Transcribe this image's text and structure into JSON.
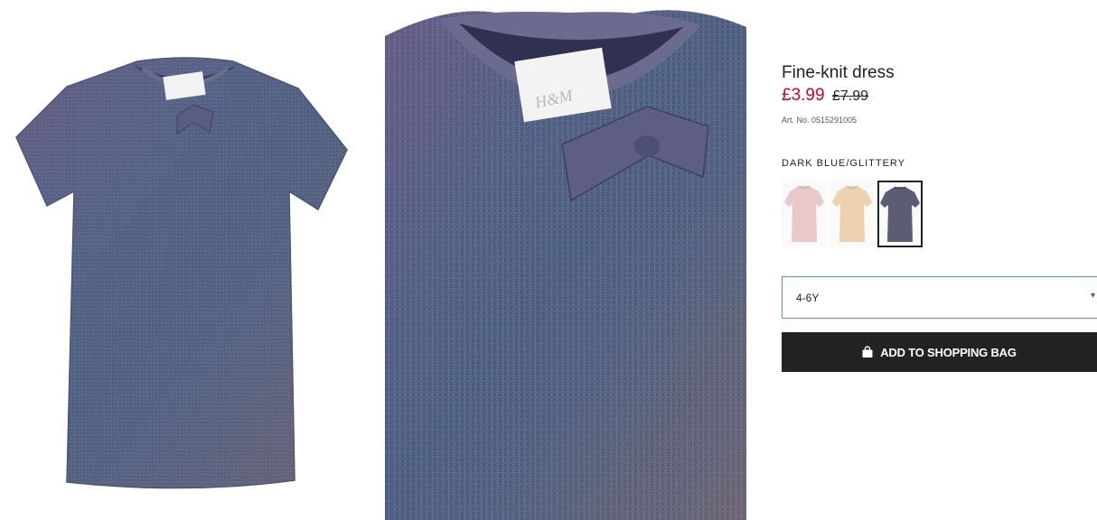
{
  "product": {
    "title": "Fine-knit dress",
    "price_current": "£3.99",
    "price_original": "£7.99",
    "article_number": "Art. No. 0515291005"
  },
  "colors": {
    "selected_label": "DARK BLUE/GLITTERY",
    "swatches": [
      {
        "name": "light pink dress",
        "color": "#e9c9c9",
        "selected": false
      },
      {
        "name": "beige dress",
        "color": "#ecd2ae",
        "selected": false
      },
      {
        "name": "dark blue glittery dress",
        "color": "#5a5d73",
        "selected": true
      }
    ]
  },
  "size": {
    "selected_value": "4-6Y",
    "caret_icon": "chevron-down-icon"
  },
  "cart": {
    "add_button_label": "ADD TO SHOPPING BAG",
    "icon": "shopping-bag-icon"
  },
  "images": {
    "main_alt_color": "#5d5a7a",
    "zoom_alt_color": "#55527a",
    "label_brand": "H&M"
  }
}
